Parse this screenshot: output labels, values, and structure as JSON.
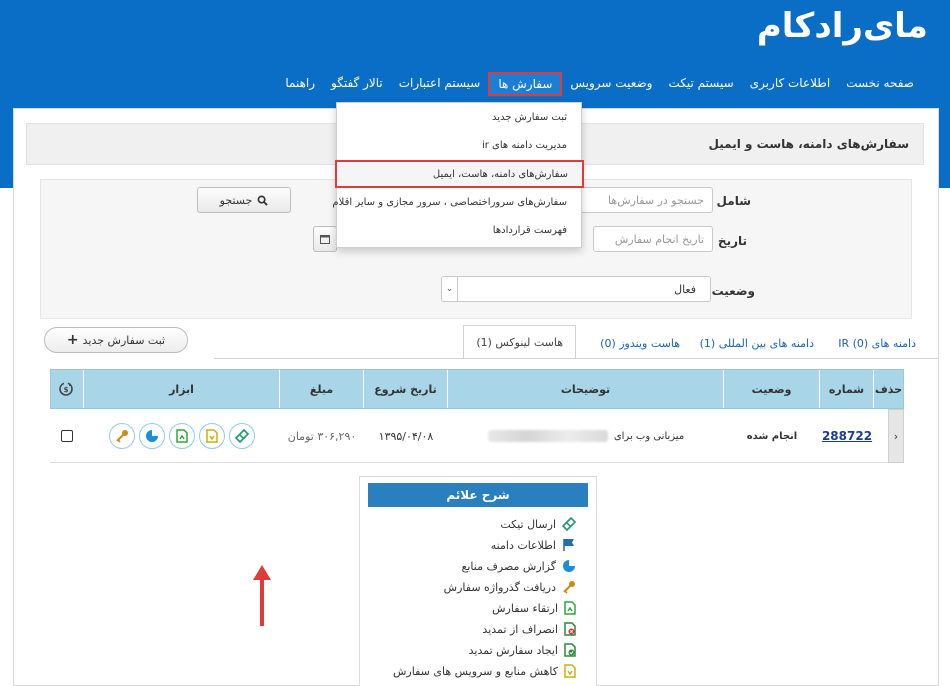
{
  "brand": {
    "logo_text": "مای‌رادکام",
    "header_color": "#0b6ec6"
  },
  "nav": {
    "items": [
      "صفحه نخست",
      "اطلاعات کاربری",
      "سیستم تیکت",
      "وضعیت سرویس",
      "سفارش ها",
      "سیستم اعتبارات",
      "تالار گفتگو",
      "راهنما"
    ],
    "active": "سفارش ها"
  },
  "dropdown": {
    "items": [
      "ثبت سفارش جدید",
      "مدیریت دامنه های ir",
      "سفارش‌های دامنه، هاست، ایمیل",
      "سفارش‌های سروراختصاصی ، سرور مجازی و سایر اقلام",
      "فهرست قراردادها"
    ],
    "highlighted": "سفارش‌های دامنه، هاست، ایمیل"
  },
  "page": {
    "title": "سفارش‌های دامنه، هاست و ایمیل"
  },
  "filter": {
    "include_label": "شامل",
    "search_placeholder": "جستجو در سفارش‌ها",
    "search_button": "جستجو",
    "date_label": "تاریخ",
    "date_placeholder": "تاریخ انجام سفارش",
    "status_label": "وضعیت",
    "status_value": "فعال"
  },
  "tabs": {
    "items": [
      "دامنه های IR (0)",
      "دامنه های بین المللی (1)",
      "هاست ویندوز (0)",
      "هاست لینوکس (1)"
    ],
    "active": "هاست لینوکس (1)",
    "new_order_button": "ثبت سفارش جدید"
  },
  "table": {
    "headers": {
      "delete": "حذف",
      "number": "شماره",
      "status": "وضعیت",
      "description": "توضیحات",
      "start_date": "تاریخ شروع",
      "amount": "مبلغ",
      "tools": "ابزار"
    },
    "rows": [
      {
        "number": "288722",
        "status": "انجام شده",
        "description": "میزبانی وب برای",
        "start_date": "۱۳۹۵/۰۴/۰۸",
        "amount": "۳۰۶,۲۹۰ تومان"
      }
    ]
  },
  "legend": {
    "title": "شرح علائم",
    "items": [
      {
        "label": "ارسال تیکت",
        "icon": "ticket-icon",
        "color": "#1a9a6a"
      },
      {
        "label": "اطلاعات دامنه",
        "icon": "flag-icon",
        "color": "#1f6fb5"
      },
      {
        "label": "گزارش مصرف منابع",
        "icon": "pie-chart-icon",
        "color": "#1a8fd6"
      },
      {
        "label": "دریافت گذرواژه سفارش",
        "icon": "key-icon",
        "color": "#d08a12"
      },
      {
        "label": "ارتقاء سفارش",
        "icon": "upgrade-doc-icon",
        "color": "#2ea83a"
      },
      {
        "label": "انصراف از تمدید",
        "icon": "cancel-renew-icon",
        "color": "#d33"
      },
      {
        "label": "ایجاد سفارش تمدید",
        "icon": "renew-doc-icon",
        "color": "#2a8a3a"
      },
      {
        "label": "کاهش منابع و سرویس های سفارش",
        "icon": "downgrade-doc-icon",
        "color": "#c9b012"
      }
    ]
  },
  "colors": {
    "accent": "#0b6ec6",
    "highlight_border": "#e03a3a",
    "table_header": "#a8d5e8",
    "arrow": "#e03a3a"
  }
}
